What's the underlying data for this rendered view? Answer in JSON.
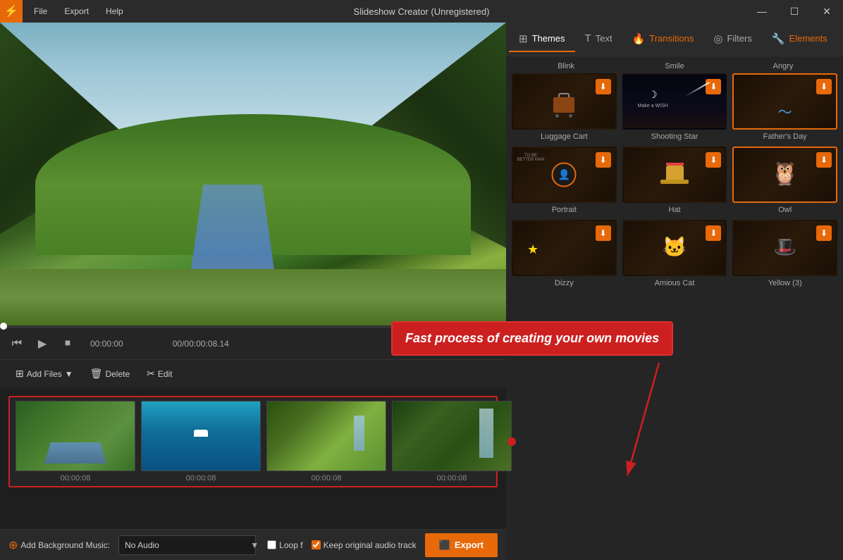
{
  "titlebar": {
    "app_name": "Slideshow Creator (Unregistered)",
    "logo": "⚡",
    "menu": {
      "file": "File",
      "export": "Export",
      "help": "Help"
    },
    "window_controls": {
      "minimize": "—",
      "maximize": "☐",
      "close": "✕"
    }
  },
  "player": {
    "time_current": "00:00:00",
    "time_separator": ".",
    "time_clip": "00/00:00:08.14"
  },
  "toolbar": {
    "add_files": "Add Files",
    "delete": "Delete",
    "edit": "Edit"
  },
  "tooltip": {
    "text": "Fast process of creating your own movies"
  },
  "clips": [
    {
      "duration": "00:00:08",
      "type": "river"
    },
    {
      "duration": "00:00:08",
      "type": "ocean"
    },
    {
      "duration": "00:00:08",
      "type": "aerial"
    },
    {
      "duration": "00:00:08",
      "type": "waterfall"
    }
  ],
  "bottom_bar": {
    "add_music_label": "Add Background Music:",
    "music_option": "No Audio",
    "loop_label": "Loop f",
    "keep_audio_label": "Keep original audio track",
    "export_label": "Export"
  },
  "tabs": [
    {
      "id": "themes",
      "label": "Themes",
      "icon": "⊞"
    },
    {
      "id": "text",
      "label": "Text",
      "icon": "T"
    },
    {
      "id": "transitions",
      "label": "Transitions",
      "icon": "🔥"
    },
    {
      "id": "filters",
      "label": "Filters",
      "icon": "⬤"
    },
    {
      "id": "elements",
      "label": "Elements",
      "icon": "🔧"
    }
  ],
  "themes": {
    "row1": [
      {
        "name": "Blink",
        "label": "Luggage Cart"
      },
      {
        "name": "Smile",
        "label": "Shooting Star"
      },
      {
        "name": "Angry",
        "label": "Father's Day"
      }
    ],
    "row2": [
      {
        "name": "",
        "label": "Portrait"
      },
      {
        "name": "",
        "label": "Hat"
      },
      {
        "name": "",
        "label": "Owl"
      }
    ],
    "row3": [
      {
        "name": "",
        "label": "Dizzy"
      },
      {
        "name": "",
        "label": "Amious Cat"
      },
      {
        "name": "",
        "label": "Yellow (3)"
      }
    ]
  }
}
